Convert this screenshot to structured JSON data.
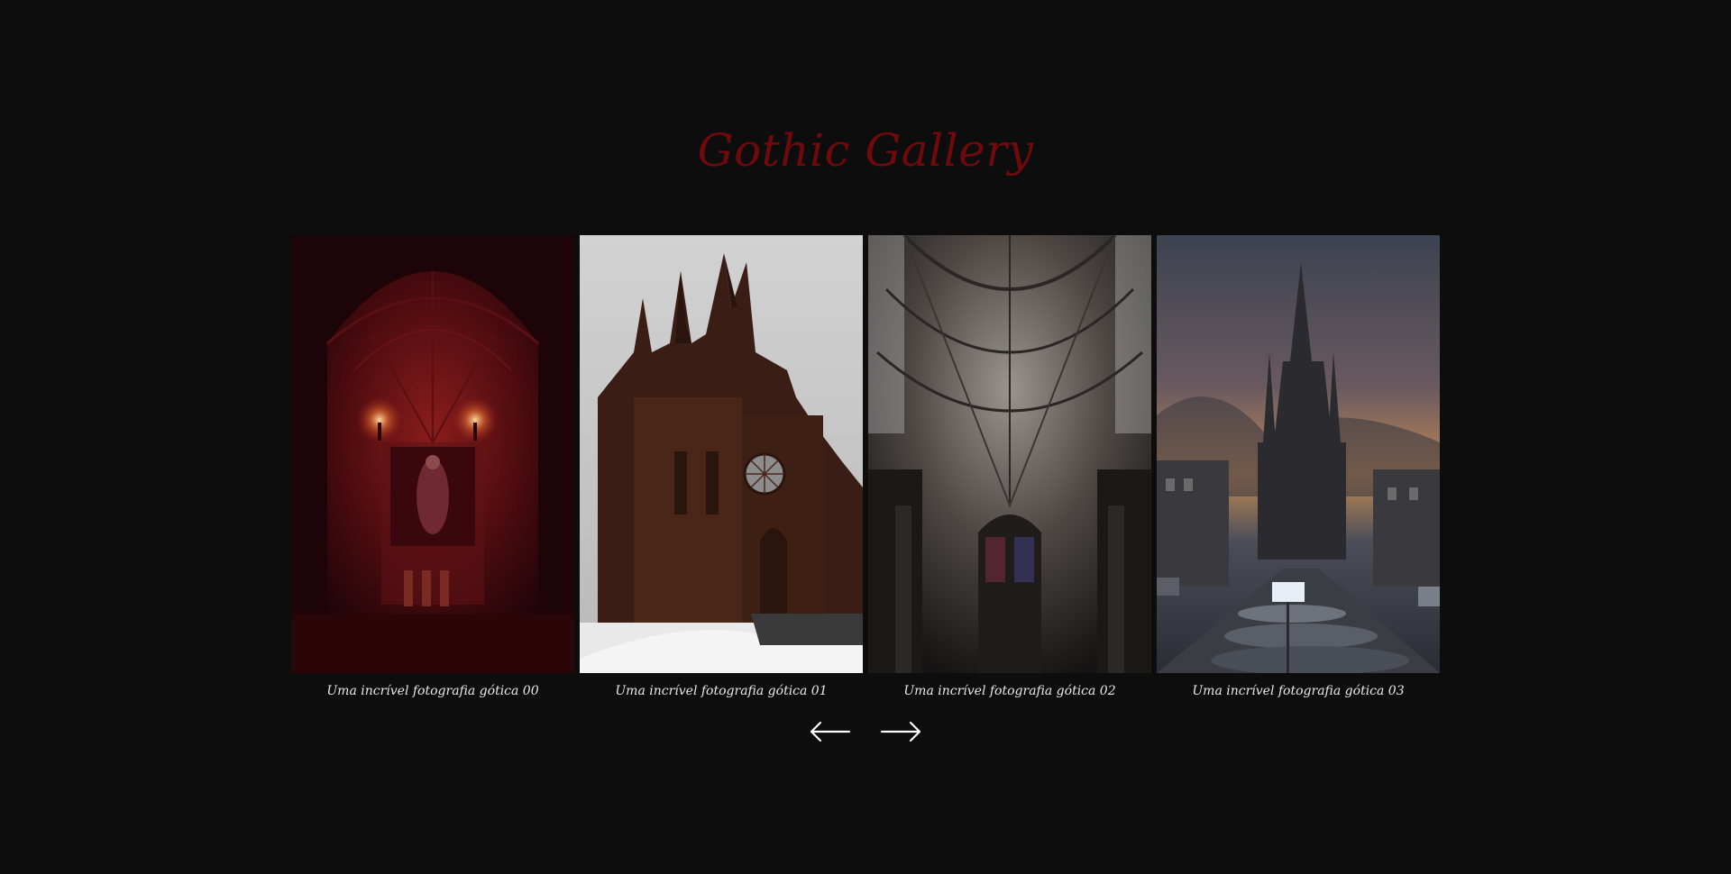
{
  "title": "Gothic Gallery",
  "colors": {
    "background": "#0d0d0d",
    "title": "#6e0a0d",
    "caption": "#e8e8e8",
    "arrows": "#ffffff"
  },
  "gallery": {
    "items": [
      {
        "caption": "Uma incrível fotografia gótica 00"
      },
      {
        "caption": "Uma incrível fotografia gótica 01"
      },
      {
        "caption": "Uma incrível fotografia gótica 02"
      },
      {
        "caption": "Uma incrível fotografia gótica 03"
      }
    ]
  },
  "navigation": {
    "prev_icon": "arrow-left-icon",
    "next_icon": "arrow-right-icon"
  }
}
